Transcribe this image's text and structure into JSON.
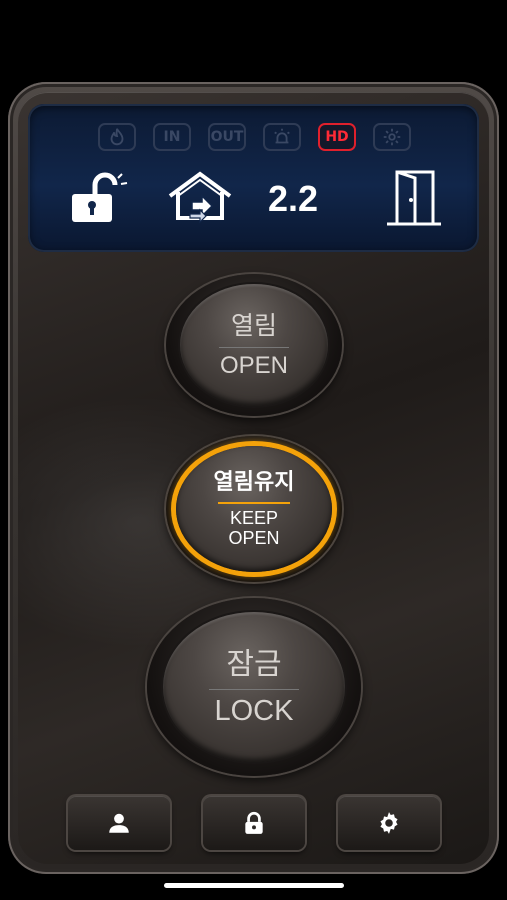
{
  "status_icons": [
    {
      "name": "fire-icon",
      "label": ""
    },
    {
      "name": "in-indicator",
      "label": "IN"
    },
    {
      "name": "out-indicator",
      "label": "OUT"
    },
    {
      "name": "alarm-icon",
      "label": ""
    },
    {
      "name": "hd-indicator",
      "label": "HD"
    },
    {
      "name": "settings-status-icon",
      "label": ""
    }
  ],
  "display": {
    "version": "2.2"
  },
  "buttons": {
    "open": {
      "ko": "열림",
      "en": "OPEN"
    },
    "keep_open": {
      "ko": "열림유지",
      "en_line1": "KEEP",
      "en_line2": "OPEN"
    },
    "lock": {
      "ko": "잠금",
      "en": "LOCK"
    }
  },
  "tabs": [
    "user-icon",
    "lock-icon",
    "gear-icon"
  ],
  "colors": {
    "accent": "#f4a20a",
    "active_red": "#e0202c",
    "screen_blue": "#11264a"
  }
}
